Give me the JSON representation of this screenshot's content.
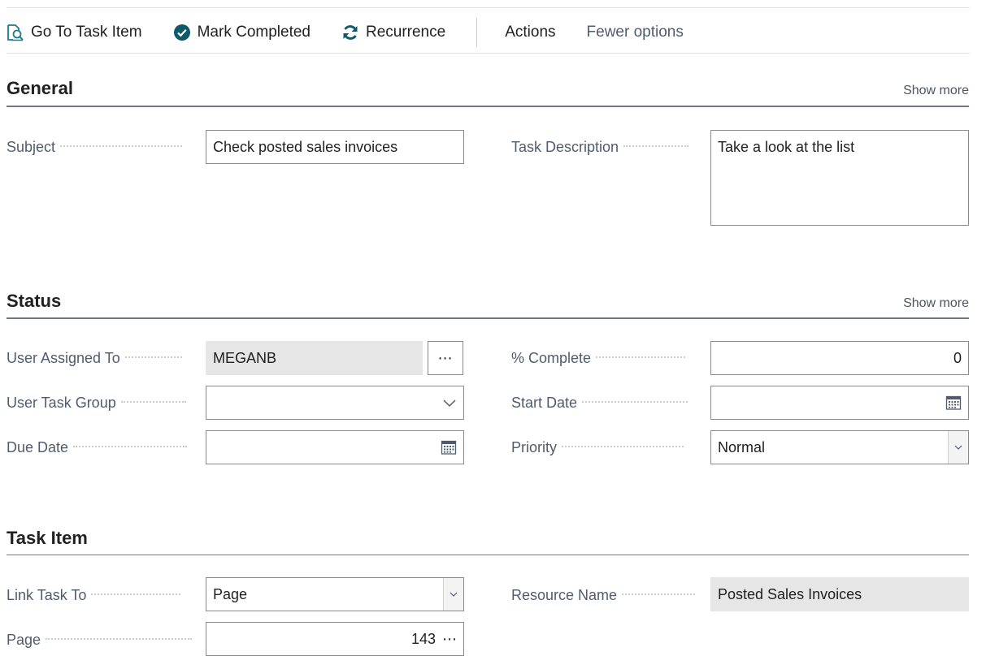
{
  "toolbar": {
    "go_to_task_item": "Go To Task Item",
    "mark_completed": "Mark Completed",
    "recurrence": "Recurrence",
    "actions": "Actions",
    "fewer_options": "Fewer options"
  },
  "sections": {
    "general": {
      "title": "General",
      "show_more": "Show more"
    },
    "status": {
      "title": "Status",
      "show_more": "Show more"
    },
    "task_item": {
      "title": "Task Item"
    }
  },
  "general": {
    "subject_label": "Subject",
    "subject_value": "Check posted sales invoices",
    "task_description_label": "Task Description",
    "task_description_value": "Take a look at the list"
  },
  "status": {
    "user_assigned_to_label": "User Assigned To",
    "user_assigned_to_value": "MEGANB",
    "user_task_group_label": "User Task Group",
    "user_task_group_value": "",
    "due_date_label": "Due Date",
    "due_date_value": "",
    "percent_complete_label": "% Complete",
    "percent_complete_value": "0",
    "start_date_label": "Start Date",
    "start_date_value": "",
    "priority_label": "Priority",
    "priority_value": "Normal"
  },
  "task_item": {
    "link_task_to_label": "Link Task To",
    "link_task_to_value": "Page",
    "page_label": "Page",
    "page_value": "143",
    "resource_name_label": "Resource Name",
    "resource_name_value": "Posted Sales Invoices"
  },
  "icons": {
    "go_to_task_item": "search-document-icon",
    "mark_completed": "check-circle-icon",
    "recurrence": "refresh-icon",
    "calendar": "calendar-icon",
    "chevron": "chevron-down-icon",
    "ellipsis": "ellipsis-icon"
  },
  "colors": {
    "accent": "#1e7a8c",
    "check_bg": "#0e5a6b",
    "section_line": "#6e7783",
    "field_border": "#8a8a8a",
    "readonly_bg": "#e6e6e6"
  }
}
